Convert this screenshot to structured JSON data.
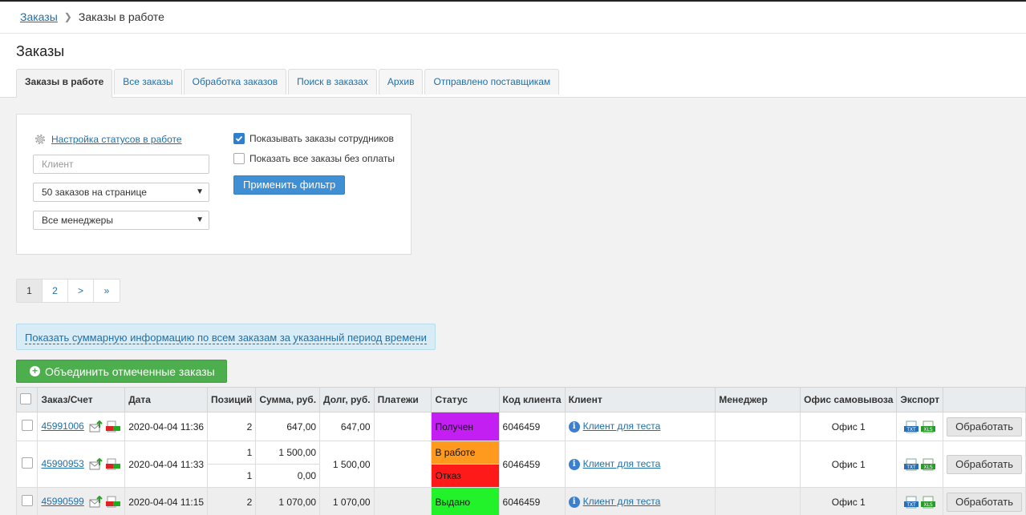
{
  "breadcrumb": {
    "root": "Заказы",
    "current": "Заказы в работе"
  },
  "page_title": "Заказы",
  "tabs": [
    {
      "label": "Заказы в работе",
      "active": true
    },
    {
      "label": "Все заказы"
    },
    {
      "label": "Обработка заказов"
    },
    {
      "label": "Поиск в заказах"
    },
    {
      "label": "Архив"
    },
    {
      "label": "Отправлено поставщикам"
    }
  ],
  "filter": {
    "settings_link": "Настройка статусов в работе",
    "client_placeholder": "Клиент",
    "per_page": "50 заказов на странице",
    "managers": "Все менеджеры",
    "show_employees": "Показывать заказы сотрудников",
    "show_unpaid": "Показать все заказы без оплаты",
    "apply": "Применить фильтр"
  },
  "pagination": [
    "1",
    "2",
    ">",
    "»"
  ],
  "summary_link": "Показать суммарную информацию по всем заказам за указанный период времени",
  "merge_button": "Объединить отмеченные заказы",
  "table": {
    "headers": [
      "Заказ/Счет",
      "Дата",
      "Позиций",
      "Сумма, руб.",
      "Долг, руб.",
      "Платежи",
      "Статус",
      "Код клиента",
      "Клиент",
      "Менеджер",
      "Офис самовывоза",
      "Экспорт"
    ],
    "process_label": "Обработать",
    "rows": [
      {
        "order": "45991006",
        "date": "2020-04-04 11:36",
        "positions": "2",
        "sum": "647,00",
        "debt": "647,00",
        "status": "Получен",
        "status_color": "#c41ff2",
        "client_code": "6046459",
        "client": "Клиент для теста",
        "office": "Офис 1"
      },
      {
        "order": "45990953",
        "date": "2020-04-04 11:33",
        "debt": "1 500,00",
        "client_code": "6046459",
        "client": "Клиент для теста",
        "office": "Офис 1",
        "sub": [
          {
            "positions": "1",
            "sum": "1 500,00",
            "status": "В работе",
            "status_color": "#ff9a1e"
          },
          {
            "positions": "1",
            "sum": "0,00",
            "status": "Отказ",
            "status_color": "#ff1a1a"
          }
        ]
      },
      {
        "order": "45990599",
        "date": "2020-04-04 11:15",
        "positions": "2",
        "sum": "1 070,00",
        "debt": "1 070,00",
        "status": "Выдано",
        "status_color": "#22f22a",
        "client_code": "6046459",
        "client": "Клиент для теста",
        "office": "Офис 1"
      }
    ]
  },
  "icons": {
    "settings": "gear-icon",
    "export_txt": "txt-file-icon",
    "export_xls": "xls-file-icon",
    "info": "info-icon",
    "email": "email-send-icon",
    "pdf": "pdf-xls-icon"
  }
}
